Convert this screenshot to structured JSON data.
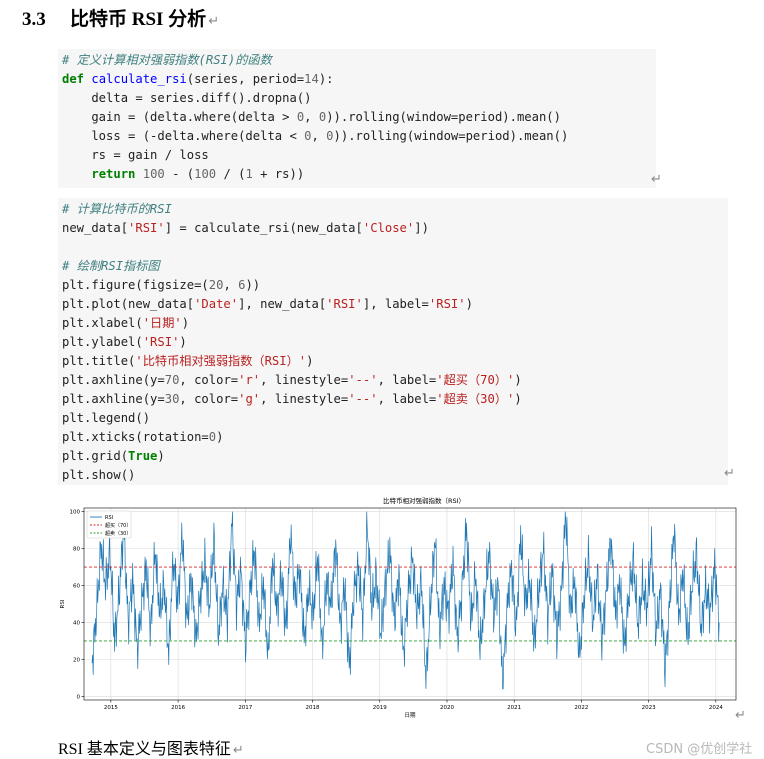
{
  "heading": {
    "number": "3.3",
    "title": "比特币 RSI 分析",
    "mark": "↵"
  },
  "code_block_1": [
    [
      {
        "t": "# 定义计算相对强弱指数(RSI)的函数",
        "c": "cm"
      }
    ],
    [
      {
        "t": "def ",
        "c": "kw"
      },
      {
        "t": "calculate_rsi",
        "c": "fn"
      },
      {
        "t": "(series, period="
      },
      {
        "t": "14",
        "c": "nm"
      },
      {
        "t": "):"
      }
    ],
    [
      {
        "t": "    delta = series.diff().dropna()"
      }
    ],
    [
      {
        "t": "    gain = (delta.where(delta > "
      },
      {
        "t": "0",
        "c": "nm"
      },
      {
        "t": ", "
      },
      {
        "t": "0",
        "c": "nm"
      },
      {
        "t": ")).rolling(window=period).mean()"
      }
    ],
    [
      {
        "t": "    loss = (-delta.where(delta < "
      },
      {
        "t": "0",
        "c": "nm"
      },
      {
        "t": ", "
      },
      {
        "t": "0",
        "c": "nm"
      },
      {
        "t": ")).rolling(window=period).mean()"
      }
    ],
    [
      {
        "t": "    rs = gain / loss"
      }
    ],
    [
      {
        "t": "    "
      },
      {
        "t": "return ",
        "c": "kw"
      },
      {
        "t": "100",
        "c": "nm"
      },
      {
        "t": " - ("
      },
      {
        "t": "100",
        "c": "nm"
      },
      {
        "t": " / ("
      },
      {
        "t": "1",
        "c": "nm"
      },
      {
        "t": " + rs))"
      }
    ]
  ],
  "code_block_2": [
    [
      {
        "t": "# 计算比特币的RSI",
        "c": "cm"
      }
    ],
    [
      {
        "t": "new_data["
      },
      {
        "t": "'RSI'",
        "c": "st"
      },
      {
        "t": "] = calculate_rsi(new_data["
      },
      {
        "t": "'Close'",
        "c": "st"
      },
      {
        "t": "])"
      }
    ],
    [
      {
        "t": ""
      }
    ],
    [
      {
        "t": "# 绘制RSI指标图",
        "c": "cm"
      }
    ],
    [
      {
        "t": "plt.figure(figsize=("
      },
      {
        "t": "20",
        "c": "nm"
      },
      {
        "t": ", "
      },
      {
        "t": "6",
        "c": "nm"
      },
      {
        "t": "))"
      }
    ],
    [
      {
        "t": "plt.plot(new_data["
      },
      {
        "t": "'Date'",
        "c": "st"
      },
      {
        "t": "], new_data["
      },
      {
        "t": "'RSI'",
        "c": "st"
      },
      {
        "t": "], label="
      },
      {
        "t": "'RSI'",
        "c": "st"
      },
      {
        "t": ")"
      }
    ],
    [
      {
        "t": "plt.xlabel("
      },
      {
        "t": "'日期'",
        "c": "st"
      },
      {
        "t": ")"
      }
    ],
    [
      {
        "t": "plt.ylabel("
      },
      {
        "t": "'RSI'",
        "c": "st"
      },
      {
        "t": ")"
      }
    ],
    [
      {
        "t": "plt.title("
      },
      {
        "t": "'比特币相对强弱指数（RSI）'",
        "c": "st"
      },
      {
        "t": ")"
      }
    ],
    [
      {
        "t": "plt.axhline(y="
      },
      {
        "t": "70",
        "c": "nm"
      },
      {
        "t": ", color="
      },
      {
        "t": "'r'",
        "c": "st"
      },
      {
        "t": ", linestyle="
      },
      {
        "t": "'--'",
        "c": "st"
      },
      {
        "t": ", label="
      },
      {
        "t": "'超买（70）'",
        "c": "st"
      },
      {
        "t": ")"
      }
    ],
    [
      {
        "t": "plt.axhline(y="
      },
      {
        "t": "30",
        "c": "nm"
      },
      {
        "t": ", color="
      },
      {
        "t": "'g'",
        "c": "st"
      },
      {
        "t": ", linestyle="
      },
      {
        "t": "'--'",
        "c": "st"
      },
      {
        "t": ", label="
      },
      {
        "t": "'超卖（30）'",
        "c": "st"
      },
      {
        "t": ")"
      }
    ],
    [
      {
        "t": "plt.legend()"
      }
    ],
    [
      {
        "t": "plt.xticks(rotation="
      },
      {
        "t": "0",
        "c": "nm"
      },
      {
        "t": ")"
      }
    ],
    [
      {
        "t": "plt.grid("
      },
      {
        "t": "True",
        "c": "kw"
      },
      {
        "t": ")"
      }
    ],
    [
      {
        "t": "plt.show()"
      }
    ]
  ],
  "paragraph_mark": "↵",
  "chart_data": {
    "type": "line",
    "title": "比特币相对强弱指数（RSI）",
    "xlabel": "日期",
    "ylabel": "RSI",
    "xlim": [
      2014.6,
      2024.3
    ],
    "ylim": [
      -2,
      102
    ],
    "xticks": [
      2015,
      2016,
      2017,
      2018,
      2019,
      2020,
      2021,
      2022,
      2023,
      2024
    ],
    "yticks": [
      0,
      20,
      40,
      60,
      80,
      100
    ],
    "grid": true,
    "legend_position": "upper-left",
    "series": [
      {
        "name": "RSI",
        "color": "#1f77b4",
        "style": "solid",
        "x_start": 2014.72,
        "x_end": 2024.05,
        "values_approx": [
          18,
          45,
          82,
          60,
          78,
          30,
          55,
          92,
          40,
          63,
          25,
          50,
          70,
          35,
          80,
          45,
          60,
          22,
          75,
          50,
          88,
          40,
          65,
          30,
          55,
          72,
          48,
          85,
          33,
          60,
          42,
          95,
          50,
          68,
          28,
          57,
          80,
          38,
          62,
          20,
          74,
          46,
          66,
          35,
          90,
          52,
          70,
          30,
          58,
          44,
          77,
          25,
          63,
          49,
          83,
          37,
          61,
          15,
          55,
          70,
          42,
          93,
          48,
          65,
          33,
          59,
          80,
          40,
          67,
          22,
          54,
          75,
          45,
          62,
          8,
          50,
          85,
          35,
          60,
          45,
          72,
          30,
          58,
          92,
          40,
          66,
          25,
          53,
          78,
          44,
          62,
          5,
          48,
          70,
          36,
          88,
          50,
          64,
          28,
          57,
          80,
          42,
          68,
          32,
          55,
          100,
          45,
          63,
          20,
          52,
          75,
          40,
          66,
          30,
          58,
          86,
          44,
          62,
          26,
          55,
          73,
          38,
          60,
          48,
          80,
          34,
          57,
          15,
          50,
          92,
          42,
          68,
          30,
          60,
          77,
          36,
          58,
          46,
          70,
          40
        ]
      },
      {
        "name": "超买（70）",
        "color": "#d62728",
        "style": "dashed",
        "y": 70
      },
      {
        "name": "超卖（30）",
        "color": "#2ca02c",
        "style": "dashed",
        "y": 30
      }
    ]
  },
  "caption": "RSI 基本定义与图表特征",
  "watermark": "CSDN @优创学社"
}
